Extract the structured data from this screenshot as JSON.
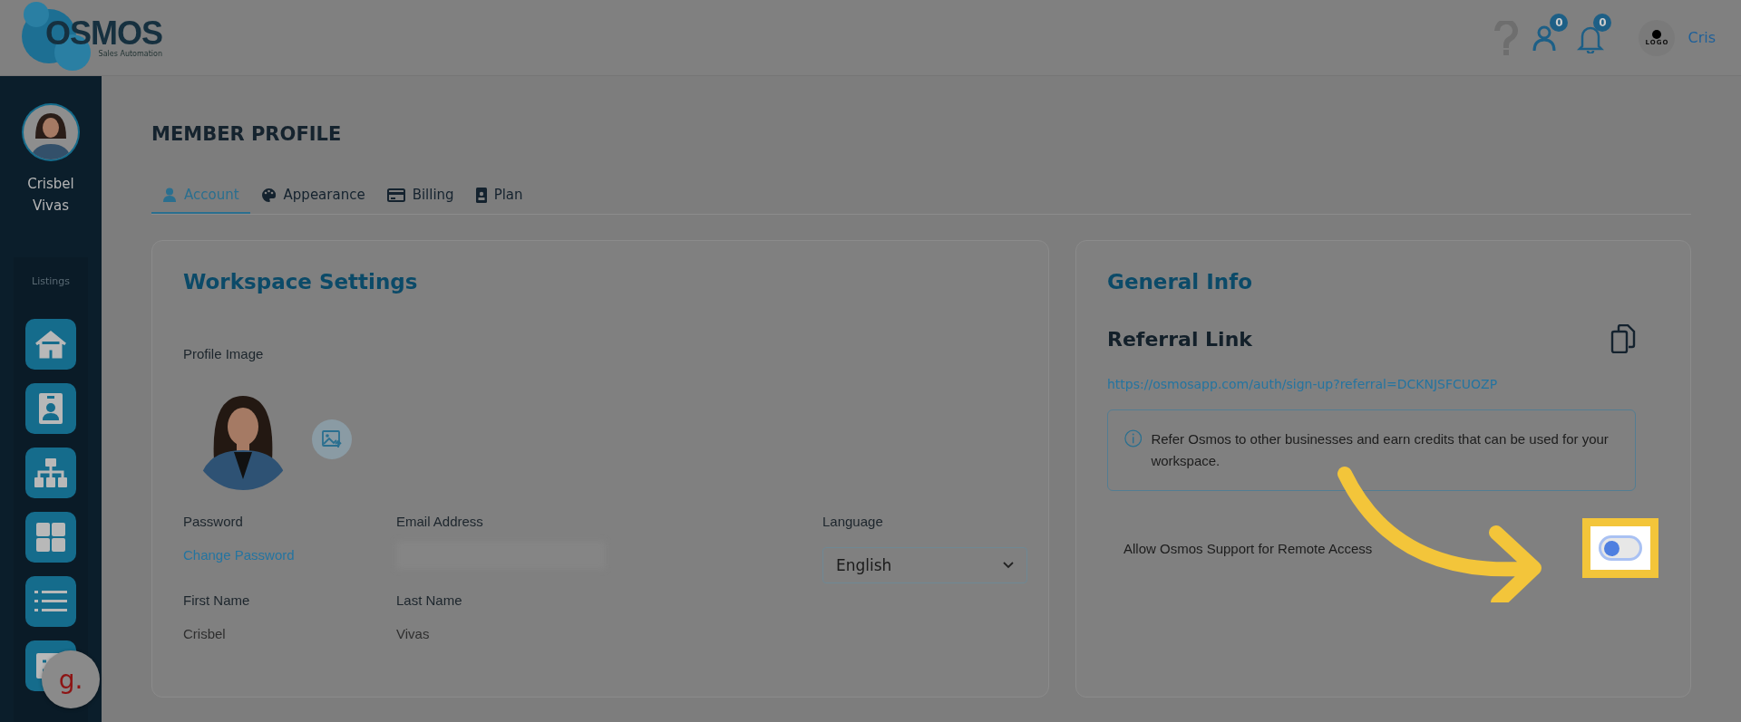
{
  "header": {
    "brand": "OSMOS",
    "tagline": "Sales Automation",
    "contacts_badge": "0",
    "notifications_badge": "0",
    "company_logo_text": "LOGO",
    "user": "Cris"
  },
  "sidebar": {
    "user_name": "Crisbel Vivas",
    "section": "Listings",
    "items": [
      {
        "kind": "home"
      },
      {
        "kind": "contact"
      },
      {
        "kind": "hierarchy"
      },
      {
        "kind": "grid"
      },
      {
        "kind": "list"
      },
      {
        "kind": "invoice"
      }
    ]
  },
  "chat_widget": {
    "label": "g."
  },
  "page": {
    "title": "MEMBER PROFILE",
    "tabs": [
      {
        "label": "Account",
        "kind": "user",
        "selected": true
      },
      {
        "label": "Appearance",
        "kind": "palette",
        "selected": false
      },
      {
        "label": "Billing",
        "kind": "card",
        "selected": false
      },
      {
        "label": "Plan",
        "kind": "badge",
        "selected": false
      }
    ]
  },
  "workspace": {
    "title": "Workspace Settings",
    "profile_image_label": "Profile Image",
    "fields": [
      {
        "label": "Password",
        "value": "Change Password",
        "kind": "link"
      },
      {
        "label": "Email Address",
        "kind": "redacted"
      },
      {
        "label": "Language",
        "value": "English",
        "kind": "select"
      },
      {
        "label": "First Name",
        "value": "Crisbel",
        "kind": "text"
      },
      {
        "label": "Last Name",
        "value": "Vivas",
        "kind": "text"
      }
    ]
  },
  "general_info": {
    "title": "General Info",
    "referral_title": "Referral Link",
    "referral_url": "https://osmosapp.com/auth/sign-up?referral=DCKNJSFCUOZP",
    "info": "Refer Osmos to other businesses and earn credits that can be used for your workspace.",
    "remote_access": {
      "label": "Allow Osmos Support for Remote Access",
      "on": false
    }
  }
}
